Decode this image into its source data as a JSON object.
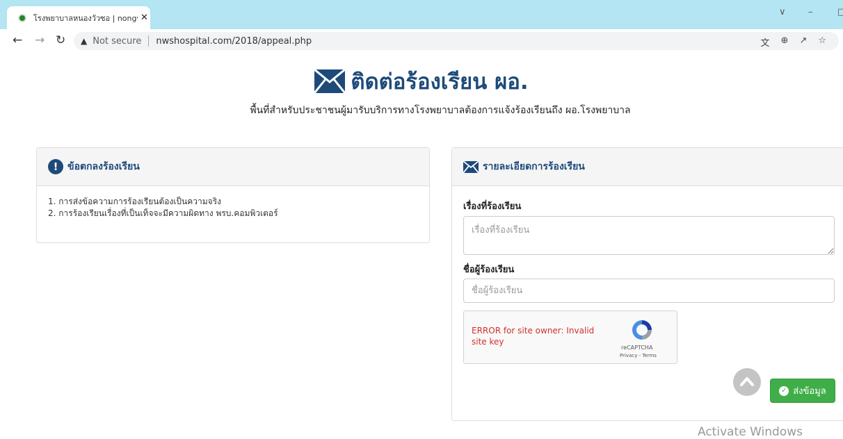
{
  "browser": {
    "tab_title": "โรงพยาบาลหนองวัวซอ | nongwu",
    "tab_close": "✕",
    "not_secure_label": "Not secure",
    "url": "nwshospital.com/2018/appeal.php"
  },
  "page": {
    "title": "ติดต่อร้องเรียน ผอ.",
    "subtitle": "พื้นที่สำหรับประชาชนผู้มารับบริการทางโรงพยาบาลต้องการแจ้งร้องเรียนถึง ผอ.โรงพยาบาล"
  },
  "terms_panel": {
    "heading": "ข้อตกลงร้องเรียน",
    "items": [
      "1. การส่งข้อความการร้องเรียนต้องเป็นความจริง",
      "2. การร้องเรียนเรื่องที่เป็นเท็จจะมีความผิดทาง พรบ.คอมพิวเตอร์"
    ]
  },
  "form_panel": {
    "heading": "รายละเอียดการร้องเรียน",
    "subject_label": "เรื่องที่ร้องเรียน",
    "subject_placeholder": "เรื่องที่ร้องเรียน",
    "subject_value": "",
    "name_label": "ชื่อผู้ร้องเรียน",
    "name_placeholder": "ชื่อผู้ร้องเรียน",
    "name_value": "",
    "recaptcha": {
      "error": "ERROR for site owner: Invalid site key",
      "brand": "reCAPTCHA",
      "links": "Privacy - Terms"
    },
    "submit_label": "ส่งข้อมูล"
  },
  "watermark": "Activate Windows",
  "colors": {
    "tabstrip": "#b3e5f2",
    "heading_blue": "#1e4a7a",
    "submit_green": "#3fae49",
    "captcha_error": "#d32f2f"
  },
  "icons": [
    "envelope-icon",
    "exclamation-circle-icon",
    "check-circle-icon",
    "chevron-up-icon",
    "recaptcha-logo-icon"
  ]
}
